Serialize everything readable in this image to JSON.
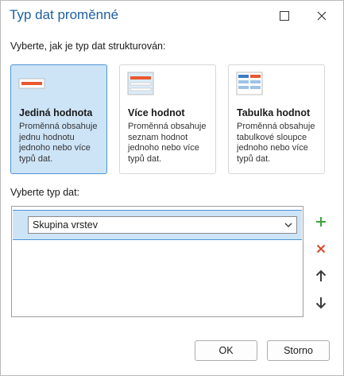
{
  "window": {
    "title": "Typ dat proměnné"
  },
  "structure": {
    "prompt": "Vyberte, jak je typ dat strukturován:",
    "options": [
      {
        "label": "Jediná hodnota",
        "description": "Proměnná obsahuje jednu hodnotu jednoho nebo více typů dat.",
        "icon": "single-value-icon",
        "selected": true
      },
      {
        "label": "Více hodnot",
        "description": "Proměnná obsahuje seznam hodnot jednoho nebo více typů dat.",
        "icon": "multi-value-icon",
        "selected": false
      },
      {
        "label": "Tabulka hodnot",
        "description": "Proměnná obsahuje tabulkové sloupce jednoho nebo více typů dat.",
        "icon": "value-table-icon",
        "selected": false
      }
    ]
  },
  "datatype": {
    "prompt": "Vyberte typ dat:",
    "rows": [
      {
        "value": "Skupina vrstev"
      }
    ]
  },
  "footer": {
    "ok_label": "OK",
    "cancel_label": "Storno"
  },
  "colors": {
    "title": "#1e5fa0",
    "selection": "#cde4f7",
    "selection_border": "#4d95d4",
    "add": "#3aa33a",
    "delete": "#d9472b",
    "icon_accent": "#e9582f"
  }
}
